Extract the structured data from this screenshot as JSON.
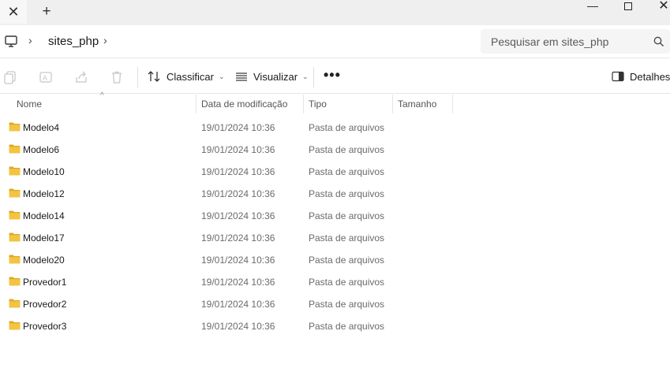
{
  "window": {
    "tab_close": "✕",
    "tab_new": "+",
    "minimize": "—",
    "close": "✕"
  },
  "address": {
    "folder": "sites_php",
    "search_placeholder": "Pesquisar em sites_php"
  },
  "toolbar": {
    "sort_label": "Classificar",
    "view_label": "Visualizar",
    "more": "•••",
    "details_label": "Detalhes"
  },
  "columns": {
    "name": "Nome",
    "modified": "Data de modificação",
    "type": "Tipo",
    "size": "Tamanho"
  },
  "files": [
    {
      "name": "Modelo4",
      "modified": "19/01/2024 10:36",
      "type": "Pasta de arquivos"
    },
    {
      "name": "Modelo6",
      "modified": "19/01/2024 10:36",
      "type": "Pasta de arquivos"
    },
    {
      "name": "Modelo10",
      "modified": "19/01/2024 10:36",
      "type": "Pasta de arquivos"
    },
    {
      "name": "Modelo12",
      "modified": "19/01/2024 10:36",
      "type": "Pasta de arquivos"
    },
    {
      "name": "Modelo14",
      "modified": "19/01/2024 10:36",
      "type": "Pasta de arquivos"
    },
    {
      "name": "Modelo17",
      "modified": "19/01/2024 10:36",
      "type": "Pasta de arquivos"
    },
    {
      "name": "Modelo20",
      "modified": "19/01/2024 10:36",
      "type": "Pasta de arquivos"
    },
    {
      "name": "Provedor1",
      "modified": "19/01/2024 10:36",
      "type": "Pasta de arquivos"
    },
    {
      "name": "Provedor2",
      "modified": "19/01/2024 10:36",
      "type": "Pasta de arquivos"
    },
    {
      "name": "Provedor3",
      "modified": "19/01/2024 10:36",
      "type": "Pasta de arquivos"
    }
  ],
  "colors": {
    "folder": "#f3c443",
    "folder_dark": "#dea823"
  }
}
